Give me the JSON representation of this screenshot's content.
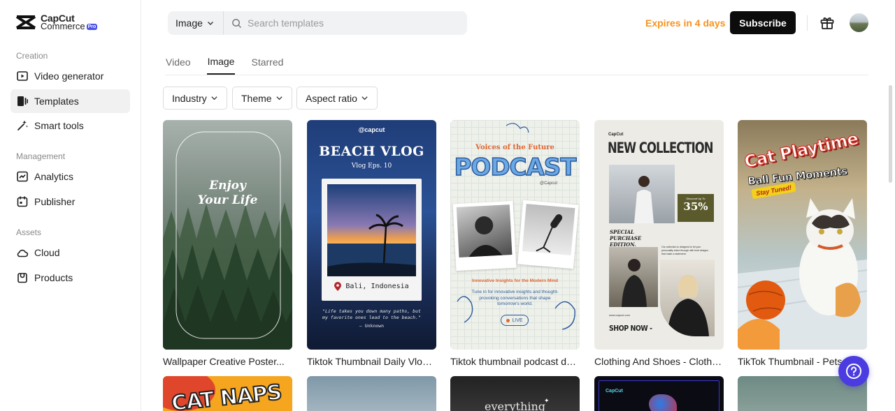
{
  "brand": {
    "name_line1": "CapCut",
    "name_line2": "Commerce",
    "badge": "Pro"
  },
  "sidebar": {
    "sections": [
      {
        "label": "Creation",
        "items": [
          {
            "label": "Video generator",
            "icon": "video-generator-icon"
          },
          {
            "label": "Templates",
            "icon": "templates-icon",
            "active": true
          },
          {
            "label": "Smart tools",
            "icon": "magic-wand-icon"
          }
        ]
      },
      {
        "label": "Management",
        "items": [
          {
            "label": "Analytics",
            "icon": "analytics-icon"
          },
          {
            "label": "Publisher",
            "icon": "calendar-icon"
          }
        ]
      },
      {
        "label": "Assets",
        "items": [
          {
            "label": "Cloud",
            "icon": "cloud-icon"
          },
          {
            "label": "Products",
            "icon": "products-icon"
          }
        ]
      }
    ]
  },
  "header": {
    "search_type": "Image",
    "search_placeholder": "Search templates",
    "expires": "Expires in 4 days",
    "subscribe": "Subscribe"
  },
  "tabs": [
    {
      "label": "Video",
      "active": false
    },
    {
      "label": "Image",
      "active": true
    },
    {
      "label": "Starred",
      "active": false
    }
  ],
  "filters": [
    {
      "label": "Industry"
    },
    {
      "label": "Theme"
    },
    {
      "label": "Aspect ratio"
    }
  ],
  "cards": [
    {
      "title": "Wallpaper Creative Poster...",
      "thumb_text": [
        "Enjoy",
        "Your Life"
      ]
    },
    {
      "title": "Tiktok Thumbnail Daily Vlog -...",
      "thumb_text": [
        "@capcut",
        "BEACH VLOG",
        "Vlog Eps. 10",
        "Bali, Indonesia",
        "\"Life takes you down many paths, but my favorite ones lead to the beach.\"",
        "— Unknown"
      ]
    },
    {
      "title": "Tiktok thumbnail podcast dai...",
      "thumb_text": [
        "Voices of the Future",
        "PODCAST",
        "@Capcut",
        "Innovative Insights for the Modern Mind",
        "Tune in for innovative insights and thought-provoking conversations that shape tomorrow's world.",
        "LIVE"
      ]
    },
    {
      "title": "Clothing And Shoes - Clothin...",
      "thumb_text": [
        "CapCut",
        "NEW COLLECTION",
        "Discount Up To",
        "35%",
        "SPECIAL PURCHASE EDITION.",
        "Our collection is designed to let your personality shine through with bold designs that make a statement.",
        "www.capcut.com",
        "SHOP NOW -"
      ]
    },
    {
      "title": "TikTok Thumbnail - Pets C...",
      "thumb_text": [
        "Cat Playtime",
        "Ball Fun Moments",
        "Stay Tuned!"
      ]
    }
  ],
  "row2": [
    {
      "thumb_text": "CAT NAPS"
    },
    {
      "thumb_text": ""
    },
    {
      "thumb_text": "everything"
    },
    {
      "thumb_text": "CapCut"
    },
    {
      "thumb_text": ""
    }
  ],
  "colors": {
    "accent_orange": "#f7931e",
    "help_purple": "#4a3ce0",
    "subscribe_bg": "#0c0c0c"
  }
}
